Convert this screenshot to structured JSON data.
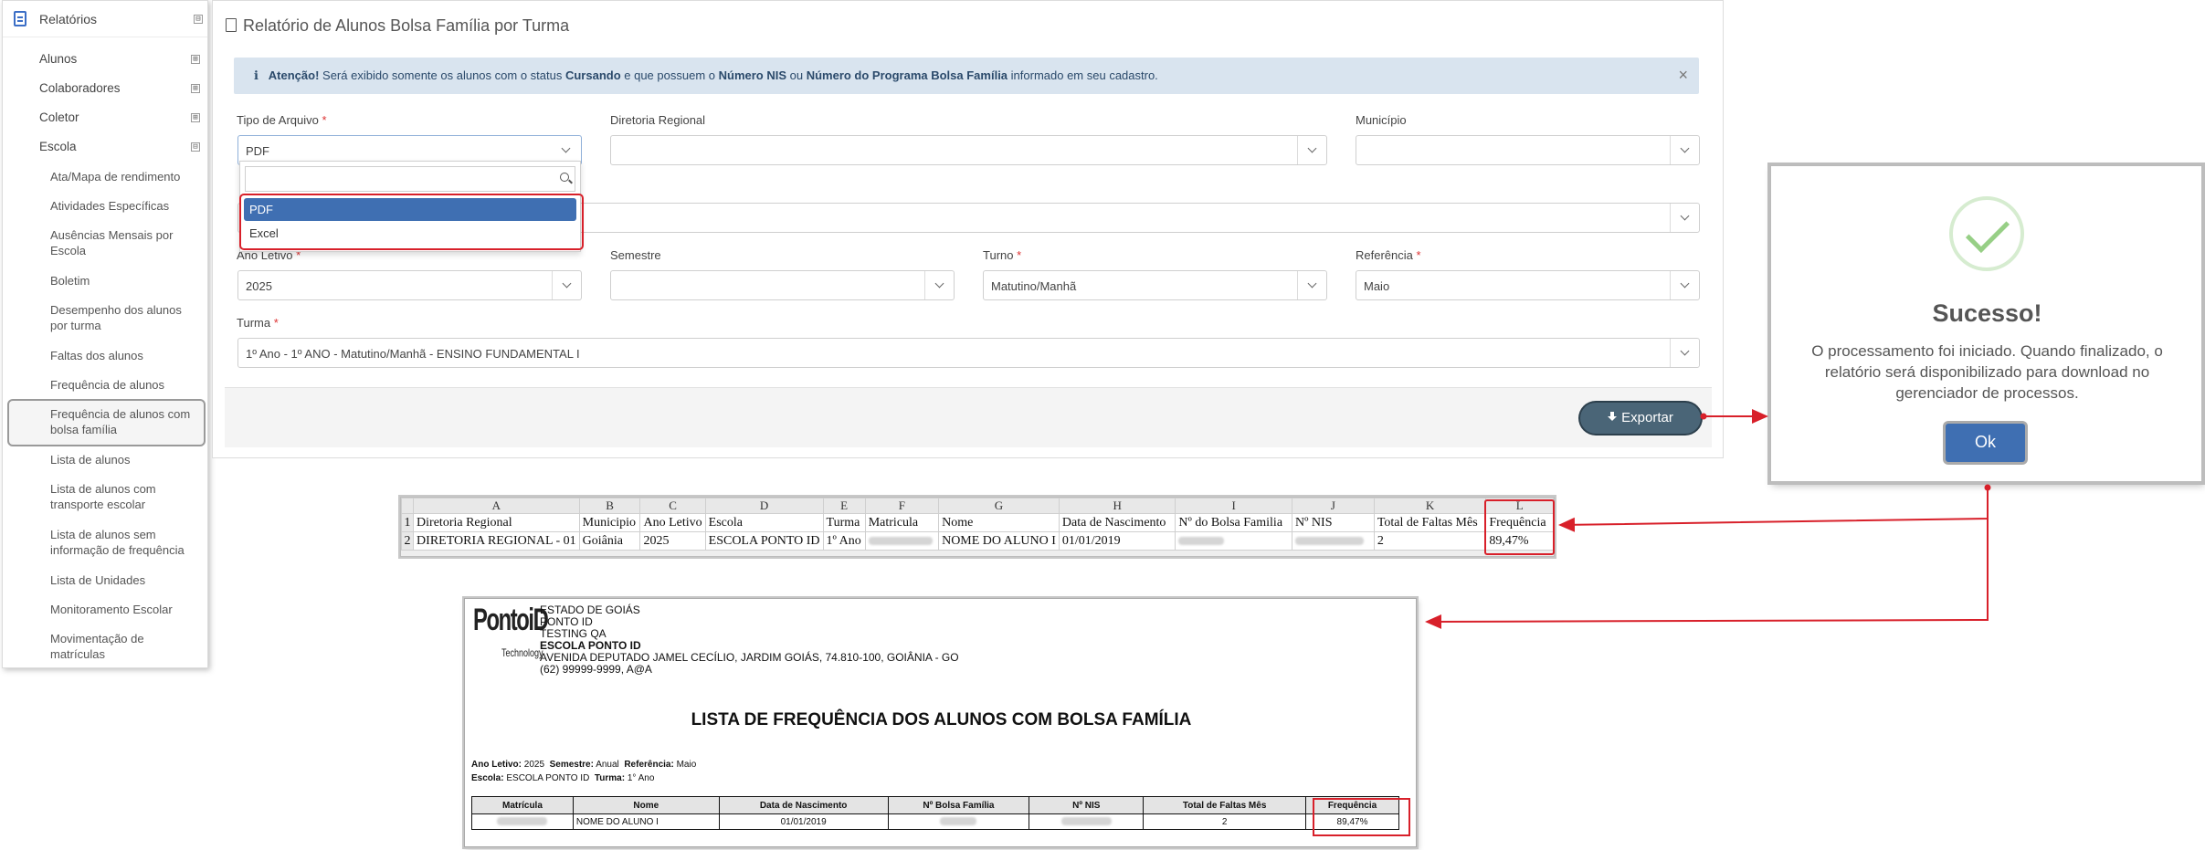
{
  "sidebar": {
    "title": "Relatórios",
    "title_toggle": "⊟",
    "groups": [
      {
        "label": "Alunos",
        "toggle": "⊞"
      },
      {
        "label": "Colaboradores",
        "toggle": "⊞"
      },
      {
        "label": "Coletor",
        "toggle": "⊞"
      },
      {
        "label": "Escola",
        "toggle": "⊟"
      }
    ],
    "escola_items": [
      "Ata/Mapa de rendimento",
      "Atividades Específicas",
      "Ausências Mensais por Escola",
      "Boletim",
      "Desempenho dos alunos por turma",
      "Faltas dos alunos",
      "Frequência de alunos",
      "Frequência de alunos com bolsa família",
      "Lista de alunos",
      "Lista de alunos com transporte escolar",
      "Lista de alunos sem informação de frequência",
      "Lista de Unidades",
      "Monitoramento Escolar",
      "Movimentação de matrículas"
    ],
    "active_item": "Frequência de alunos com bolsa família"
  },
  "main": {
    "title": "Relatório de Alunos Bolsa Família por Turma",
    "alert": {
      "icon": "info-icon",
      "prefix": "Atenção!",
      "text1": " Será exibido somente os alunos com o status ",
      "status": "Cursando",
      "text2": " e que possuem o ",
      "nis": "Número NIS",
      "text3": " ou ",
      "programa": "Número do Programa Bolsa Família",
      "text4": " informado em seu cadastro.",
      "close": "×"
    },
    "fields": {
      "tipo_arquivo": {
        "label": "Tipo de Arquivo",
        "required": "*",
        "value": "PDF"
      },
      "diretoria_regional": {
        "label": "Diretoria Regional",
        "value": ""
      },
      "municipio": {
        "label": "Município",
        "value": ""
      },
      "ano_letivo": {
        "label": "Ano Letivo",
        "required": "*",
        "value": "2025"
      },
      "semestre": {
        "label": "Semestre",
        "value": ""
      },
      "turno": {
        "label": "Turno",
        "required": "*",
        "value": "Matutino/Manhã"
      },
      "referencia": {
        "label": "Referência",
        "required": "*",
        "value": "Maio"
      },
      "turma": {
        "label": "Turma",
        "required": "*",
        "value": "1º Ano - 1º ANO - Matutino/Manhã - ENSINO FUNDAMENTAL I"
      }
    },
    "dropdown": {
      "options": [
        "PDF",
        "Excel"
      ],
      "selected": "PDF"
    },
    "export_button": "Exportar"
  },
  "success_dialog": {
    "icon": "check-icon",
    "title": "Sucesso!",
    "message": "O processamento foi iniciado. Quando finalizado, o relatório será disponibilizado para download no gerenciador de processos.",
    "ok_button": "Ok"
  },
  "spreadsheet": {
    "columns": [
      "A",
      "B",
      "C",
      "D",
      "E",
      "F",
      "G",
      "H",
      "I",
      "J",
      "K",
      "L"
    ],
    "rows": [
      {
        "num": "1",
        "cells": [
          "Diretoria Regional",
          "Municipio",
          "Ano Letivo",
          "Escola",
          "Turma",
          "Matricula",
          "Nome",
          "Data de Nascimento",
          "Nº do Bolsa Familia",
          "Nº NIS",
          "Total de Faltas Mês",
          "Frequência"
        ]
      },
      {
        "num": "2",
        "cells": [
          "DIRETORIA REGIONAL - 01",
          "Goiânia",
          "2025",
          "ESCOLA PONTO ID",
          "1º Ano",
          "",
          "NOME DO ALUNO I",
          "01/01/2019",
          "",
          "",
          "2",
          "89,47%"
        ]
      }
    ]
  },
  "pdf_report": {
    "logo": "PontoiD",
    "logo_sub": "Technology",
    "header_lines": [
      "ESTADO DE GOIÁS",
      "PONTO ID",
      "TESTING QA",
      "ESCOLA PONTO ID",
      "AVENIDA DEPUTADO JAMEL CECÍLIO, JARDIM GOIÁS, 74.810-100, GOIÂNIA - GO",
      "(62) 99999-9999, A@A"
    ],
    "title": "LISTA DE FREQUÊNCIA DOS ALUNOS COM BOLSA FAMÍLIA",
    "meta": {
      "ano_letivo_label": "Ano Letivo:",
      "ano_letivo": "2025",
      "semestre_label": "Semestre:",
      "semestre": "Anual",
      "referencia_label": "Referência:",
      "referencia": "Maio",
      "escola_label": "Escola:",
      "escola": "ESCOLA PONTO ID",
      "turma_label": "Turma:",
      "turma": "1° Ano"
    },
    "table_headers": [
      "Matrícula",
      "Nome",
      "Data de Nascimento",
      "Nº Bolsa Família",
      "Nº NIS",
      "Total de Faltas Mês",
      "Frequência"
    ],
    "table_rows": [
      [
        "",
        "NOME DO ALUNO I",
        "01/01/2019",
        "",
        "",
        "2",
        "89,47%"
      ]
    ]
  },
  "colors": {
    "highlight": "#d8202a",
    "primary": "#3f6fb2",
    "success": "#97cf86",
    "export": "#4a6577"
  }
}
